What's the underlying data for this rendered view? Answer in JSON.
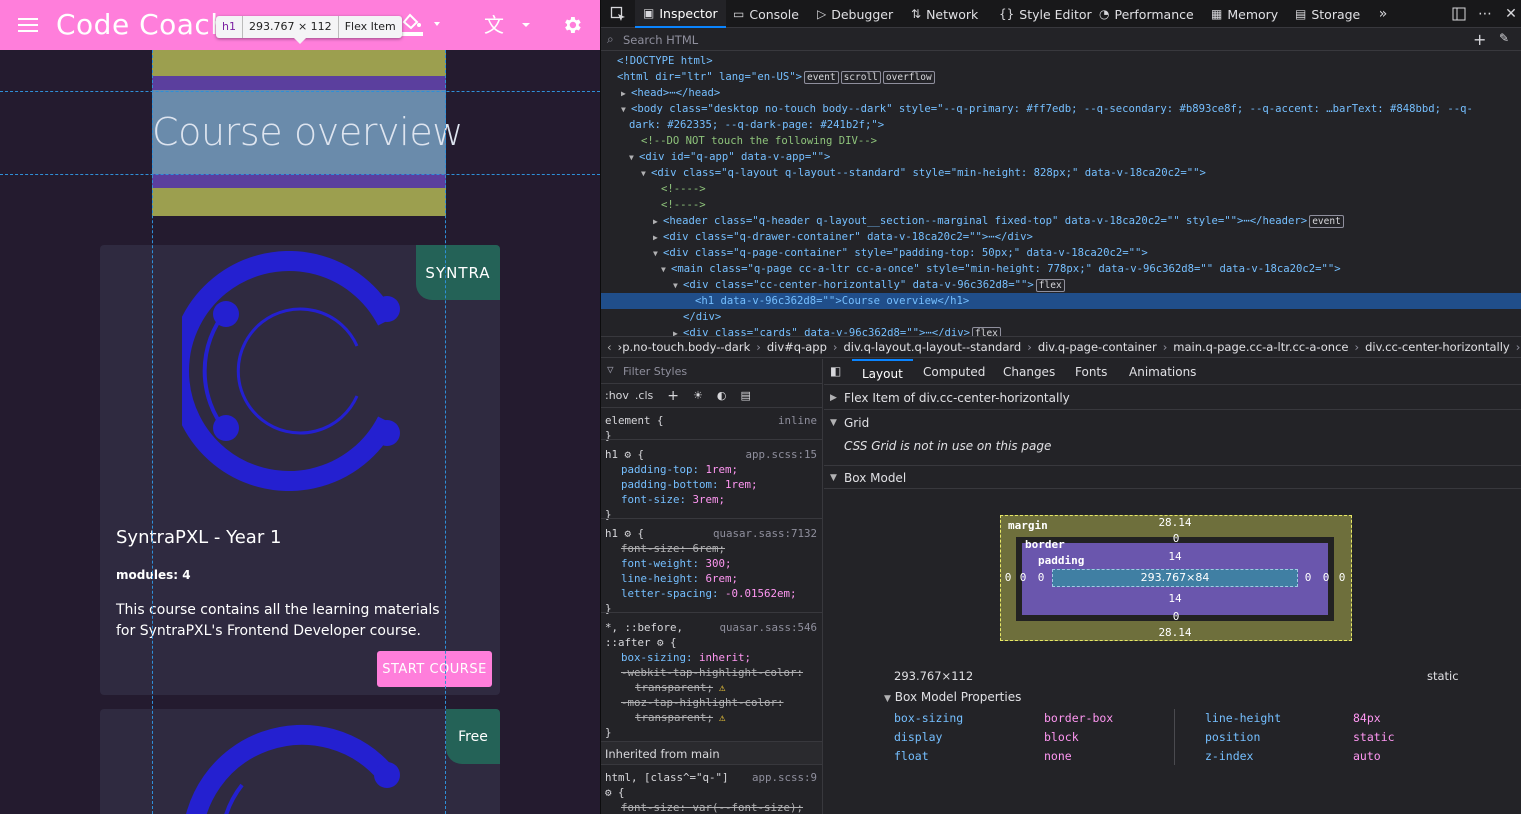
{
  "app": {
    "brand": "Code Coach",
    "h1": "Course overview",
    "tooltip": {
      "tag": "h1",
      "size": "293.767 × 112",
      "kind": "Flex Item"
    },
    "cards": [
      {
        "badge": "SYNTRA",
        "title": "SyntraPXL - Year 1",
        "modules": "modules: 4",
        "description": "This course contains all the learning materials for SyntraPXL's Frontend Developer course.",
        "button": "START COURSE"
      },
      {
        "badge": "Free"
      }
    ],
    "colors": {
      "primary": "#ff7edb",
      "secondary": "#b893ce",
      "dark_page": "#241b2f",
      "badge": "#246257",
      "logo": "#2420d0"
    }
  },
  "devtools": {
    "tabs": [
      "Inspector",
      "Console",
      "Debugger",
      "Network",
      "Style Editor",
      "Performance",
      "Memory",
      "Storage"
    ],
    "search_placeholder": "Search HTML",
    "markup": [
      {
        "t": "<!DOCTYPE html>"
      },
      {
        "t": "<html dir=\"ltr\" lang=\"en-US\">",
        "badges": [
          "event",
          "scroll",
          "overflow"
        ]
      },
      {
        "t": "<head>⋯</head>"
      },
      {
        "t": "<body class=\"desktop no-touch body--dark\" style=\"--q-primary: #ff7edb; --q-secondary: #b893ce8f; --q-accent: …barText: #848bbd; --q-"
      },
      {
        "t": "dark: #262335; --q-dark-page: #241b2f;\">"
      },
      {
        "t": "<!--DO NOT touch the following DIV-->"
      },
      {
        "t": "<div id=\"q-app\" data-v-app=\"\">"
      },
      {
        "t": "<div class=\"q-layout q-layout--standard\" style=\"min-height: 828px;\" data-v-18ca20c2=\"\">"
      },
      {
        "t": "<!---->"
      },
      {
        "t": "<!---->"
      },
      {
        "t": "<header class=\"q-header q-layout__section--marginal fixed-top\" data-v-18ca20c2=\"\" style=\"\">⋯</header>",
        "badges": [
          "event"
        ]
      },
      {
        "t": "<div class=\"q-drawer-container\" data-v-18ca20c2=\"\">⋯</div>"
      },
      {
        "t": "<div class=\"q-page-container\" style=\"padding-top: 50px;\" data-v-18ca20c2=\"\">"
      },
      {
        "t": "<main class=\"q-page cc-a-ltr cc-a-once\" style=\"min-height: 778px;\" data-v-96c362d8=\"\" data-v-18ca20c2=\"\">"
      },
      {
        "t": "<div class=\"cc-center-horizontally\" data-v-96c362d8=\"\">",
        "badges": [
          "flex"
        ]
      },
      {
        "t": "<h1 data-v-96c362d8=\"\">Course overview</h1>"
      },
      {
        "t": "</div>"
      },
      {
        "t": "<div class=\"cards\" data-v-96c362d8=\"\">⋯</div>",
        "badges": [
          "flex"
        ]
      }
    ],
    "breadcrumbs": [
      "›p.no-touch.body--dark",
      "div#q-app",
      "div.q-layout.q-layout--standard",
      "div.q-page-container",
      "main.q-page.cc-a-ltr.cc-a-once",
      "div.cc-center-horizontally",
      "h1"
    ],
    "rules": {
      "filter_placeholder": "Filter Styles",
      "tools": [
        ":hov",
        ".cls"
      ],
      "lines": [
        {
          "kind": "sel",
          "text": "element {",
          "src": "inline"
        },
        {
          "kind": "end",
          "text": "}"
        },
        {
          "kind": "sel",
          "text": "h1 ⚙ {",
          "src": "app.scss:15"
        },
        {
          "kind": "prop",
          "p": "padding-top",
          "v": "1rem;"
        },
        {
          "kind": "prop",
          "p": "padding-bottom",
          "v": "1rem;"
        },
        {
          "kind": "prop",
          "p": "font-size",
          "v": "3rem;"
        },
        {
          "kind": "end",
          "text": "}"
        },
        {
          "kind": "sel",
          "text": "h1 ⚙ {",
          "src": "quasar.sass:7132"
        },
        {
          "kind": "strike",
          "p": "font-size",
          "v": "6rem;"
        },
        {
          "kind": "prop",
          "p": "font-weight",
          "v": "300;"
        },
        {
          "kind": "prop",
          "p": "line-height",
          "v": "6rem;"
        },
        {
          "kind": "prop",
          "p": "letter-spacing",
          "v": "-0.01562em;"
        },
        {
          "kind": "end",
          "text": "}"
        },
        {
          "kind": "sel",
          "text": "*, ::before,",
          "src": "quasar.sass:546"
        },
        {
          "kind": "sel",
          "text": "::after ⚙ {",
          "src": ""
        },
        {
          "kind": "prop",
          "p": "box-sizing",
          "v": "inherit;"
        },
        {
          "kind": "strike",
          "p": "-webkit-tap-highlight-color",
          "v": ""
        },
        {
          "kind": "strike2",
          "p": "transparent;",
          "v": ""
        },
        {
          "kind": "strike",
          "p": "-moz-tap-highlight-color",
          "v": ""
        },
        {
          "kind": "strike2",
          "p": "transparent;",
          "v": ""
        },
        {
          "kind": "end",
          "text": "}"
        }
      ],
      "inherited": "Inherited from main",
      "inherited_sel": "html, [class^=\"q-\"]",
      "inherited_src": "app.scss:9",
      "inherited_last": "font-size: var(--font-size);"
    },
    "layout_tabs": [
      "Layout",
      "Computed",
      "Changes",
      "Fonts",
      "Animations"
    ],
    "flex_item": "Flex Item of div.cc-center-horizontally",
    "grid": "Grid",
    "grid_msg": "CSS Grid is not in use on this page",
    "box_model": "Box Model",
    "bm": {
      "margin_lbl": "margin",
      "border_lbl": "border",
      "padding_lbl": "padding",
      "margin_top": "28.14",
      "margin_bottom": "28.14",
      "margin_left": "0",
      "margin_right": "0",
      "border_top": "0",
      "border_bottom": "0",
      "border_left": "0",
      "border_right": "0",
      "padding_top": "14",
      "padding_bottom": "14",
      "padding_left": "0",
      "padding_right": "0",
      "content": "293.767×84"
    },
    "dims": "293.767×112",
    "position": "static",
    "props_hdr": "Box Model Properties",
    "props": [
      {
        "k": "box-sizing",
        "v": "border-box"
      },
      {
        "k": "display",
        "v": "block"
      },
      {
        "k": "float",
        "v": "none"
      },
      {
        "k": "line-height",
        "v": "84px"
      },
      {
        "k": "position",
        "v": "static"
      },
      {
        "k": "z-index",
        "v": "auto"
      }
    ]
  }
}
